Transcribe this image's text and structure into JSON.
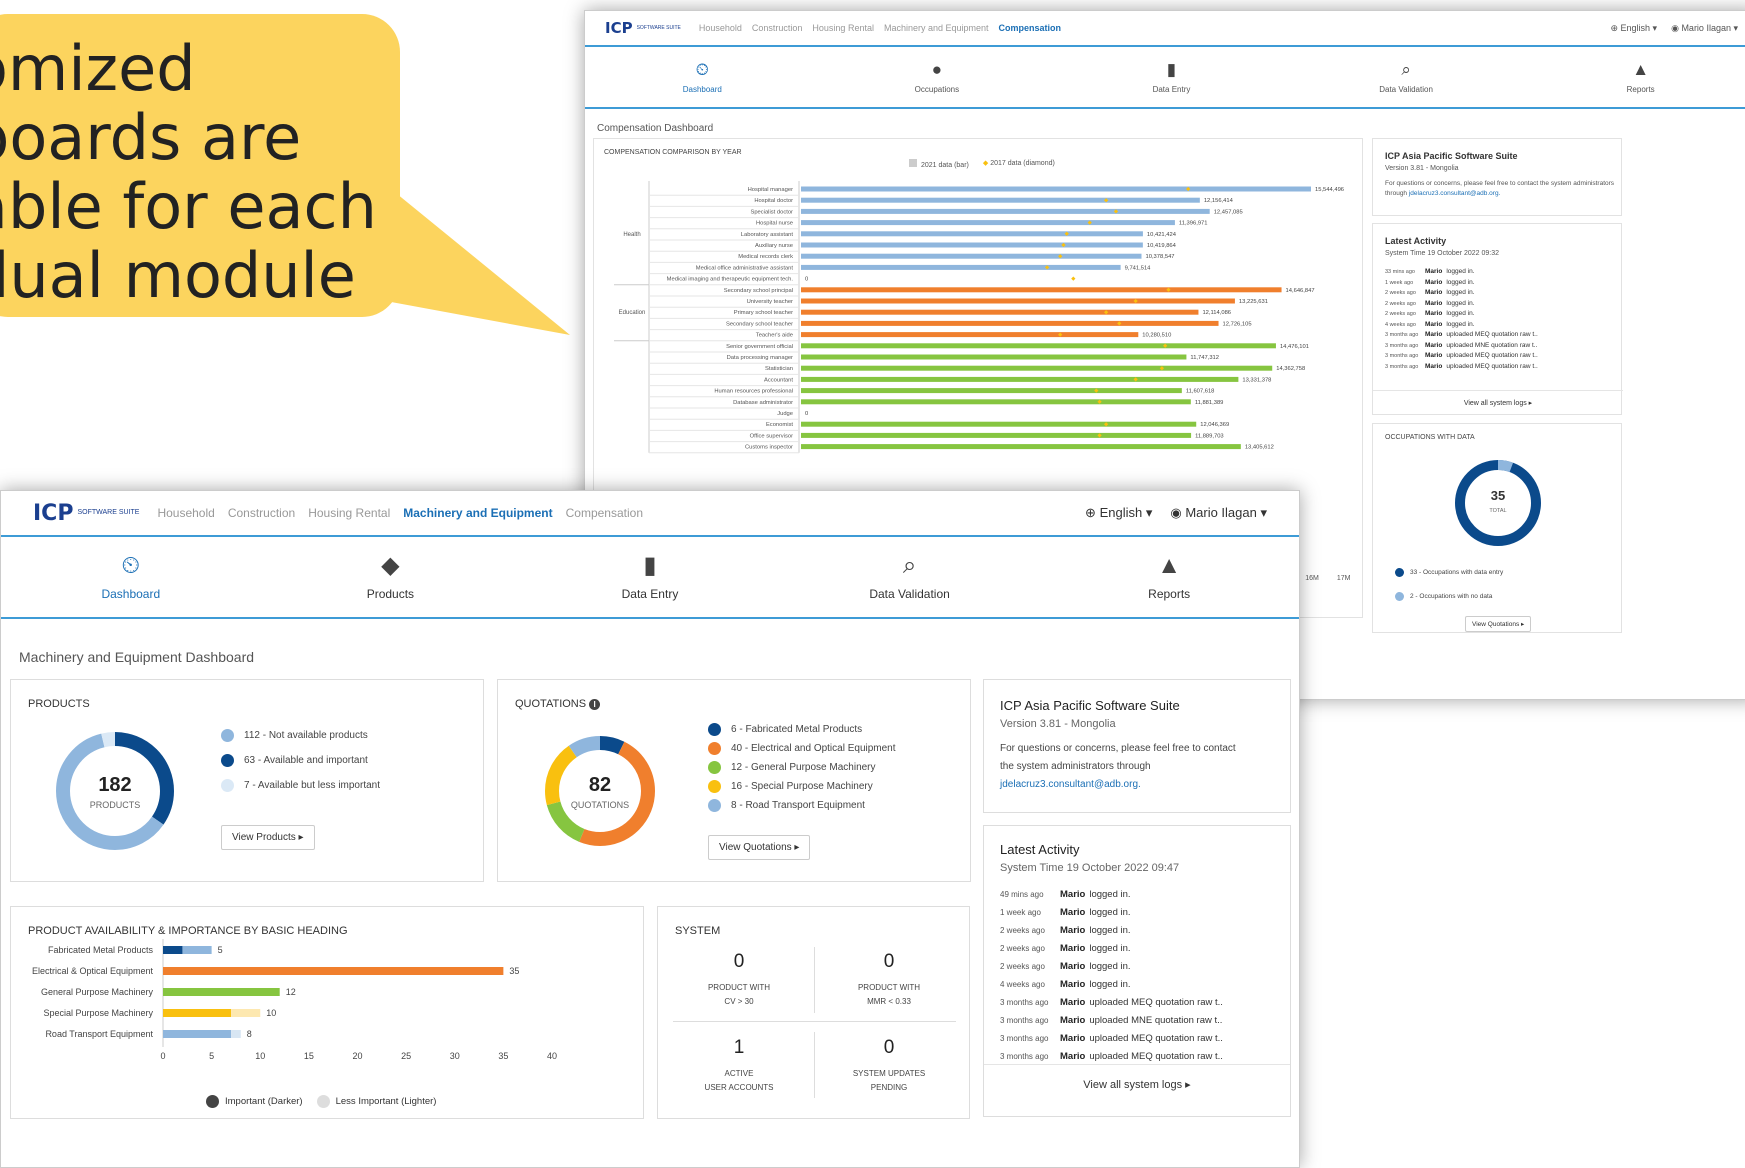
{
  "callout": {
    "lines": [
      "omized",
      "boards are",
      "able for each",
      "dual module"
    ]
  },
  "colors": {
    "callout": "#fcd45e",
    "dark_blue": "#0b4a8b",
    "light_blue": "#8fb6dd",
    "orange": "#f07f2d",
    "green": "#86c540",
    "yellow": "#f9c00f",
    "accent": "#1b6fb5"
  },
  "back": {
    "logo": "ICP",
    "logo_sub": "SOFTWARE SUITE",
    "nav": [
      "Household",
      "Construction",
      "Housing Rental",
      "Machinery and Equipment",
      "Compensation"
    ],
    "nav_active": "Compensation",
    "lang": "English",
    "user": "Mario Ilagan",
    "icons": [
      {
        "label": "Dashboard",
        "icon": "dashboard-icon"
      },
      {
        "label": "Occupations",
        "icon": "user-icon"
      },
      {
        "label": "Data Entry",
        "icon": "file-upload-icon"
      },
      {
        "label": "Data Validation",
        "icon": "search-icon"
      },
      {
        "label": "Reports",
        "icon": "area-chart-icon"
      }
    ],
    "page_title": "Compensation Dashboard",
    "chart_title": "COMPENSATION COMPARISON BY YEAR",
    "legend_2021": "2021 data (bar)",
    "legend_2017": "2017 data (diamond)",
    "groups": [
      {
        "name": "Health"
      },
      {
        "name": "Education"
      }
    ],
    "x_ticks": [
      "14M",
      "15M",
      "16M",
      "17M"
    ],
    "info_title": "ICP Asia Pacific Software Suite",
    "info_version": "Version 3.81 - Mongolia",
    "info_text": "For questions or concerns, please feel free to contact the system administrators through",
    "info_email": "jdelacruz3.consultant@adb.org.",
    "activity_title": "Latest Activity",
    "system_time": "System Time 19 October 2022 09:32",
    "activity": [
      {
        "t": "33 mins ago",
        "who": "Mario",
        "what": "logged in."
      },
      {
        "t": "1 week ago",
        "who": "Mario",
        "what": "logged in."
      },
      {
        "t": "2 weeks ago",
        "who": "Mario",
        "what": "logged in."
      },
      {
        "t": "2 weeks ago",
        "who": "Mario",
        "what": "logged in."
      },
      {
        "t": "2 weeks ago",
        "who": "Mario",
        "what": "logged in."
      },
      {
        "t": "4 weeks ago",
        "who": "Mario",
        "what": "logged in."
      },
      {
        "t": "3 months ago",
        "who": "Mario",
        "what": "uploaded MEQ quotation raw t.."
      },
      {
        "t": "3 months ago",
        "who": "Mario",
        "what": "uploaded MNE quotation raw t.."
      },
      {
        "t": "3 months ago",
        "who": "Mario",
        "what": "uploaded MEQ quotation raw t.."
      },
      {
        "t": "3 months ago",
        "who": "Mario",
        "what": "uploaded MEQ quotation raw t.."
      }
    ],
    "view_logs": "View all system logs",
    "occ_title": "OCCUPATIONS WITH DATA",
    "occ_total": "35",
    "occ_total_label": "TOTAL",
    "occ_legend": [
      "33 - Occupations with data entry",
      "2 - Occupations with no data"
    ],
    "view_quotations": "View Quotations"
  },
  "front": {
    "logo": "ICP",
    "logo_sub": "SOFTWARE SUITE",
    "nav": [
      "Household",
      "Construction",
      "Housing Rental",
      "Machinery and Equipment",
      "Compensation"
    ],
    "nav_active": "Machinery and Equipment",
    "lang": "English",
    "user": "Mario Ilagan",
    "icons": [
      {
        "label": "Dashboard",
        "icon": "dashboard-icon"
      },
      {
        "label": "Products",
        "icon": "tags-icon"
      },
      {
        "label": "Data Entry",
        "icon": "file-upload-icon"
      },
      {
        "label": "Data Validation",
        "icon": "search-icon"
      },
      {
        "label": "Reports",
        "icon": "area-chart-icon"
      }
    ],
    "page_title": "Machinery and Equipment Dashboard",
    "products": {
      "title": "PRODUCTS",
      "total": "182",
      "total_label": "PRODUCTS",
      "legend": [
        {
          "label": "112 - Not available products",
          "color": "#8fb6dd",
          "value": 112
        },
        {
          "label": "63 - Available and important",
          "color": "#0b4a8b",
          "value": 63
        },
        {
          "label": "7 - Available but less important",
          "color": "#dbe9f6",
          "value": 7
        }
      ],
      "button": "View Products"
    },
    "quotations": {
      "title": "QUOTATIONS",
      "total": "82",
      "total_label": "QUOTATIONS",
      "legend": [
        {
          "label": "6 - Fabricated Metal Products",
          "color": "#0b4a8b",
          "value": 6
        },
        {
          "label": "40 - Electrical and Optical Equipment",
          "color": "#f07f2d",
          "value": 40
        },
        {
          "label": "12 - General Purpose Machinery",
          "color": "#86c540",
          "value": 12
        },
        {
          "label": "16 - Special Purpose Machinery",
          "color": "#f9c00f",
          "value": 16
        },
        {
          "label": "8 - Road Transport Equipment",
          "color": "#8fb6dd",
          "value": 8
        }
      ],
      "button": "View Quotations"
    },
    "availability": {
      "title": "PRODUCT AVAILABILITY & IMPORTANCE BY BASIC HEADING",
      "legend_dark": "Important (Darker)",
      "legend_light": "Less Important (Lighter)"
    },
    "system": {
      "title": "SYSTEM",
      "cells": [
        {
          "value": "0",
          "line1": "PRODUCT WITH",
          "line2": "CV > 30"
        },
        {
          "value": "0",
          "line1": "PRODUCT WITH",
          "line2": "MMR < 0.33"
        },
        {
          "value": "1",
          "line1": "ACTIVE",
          "line2": "USER ACCOUNTS"
        },
        {
          "value": "0",
          "line1": "SYSTEM UPDATES",
          "line2": "PENDING"
        }
      ]
    },
    "info": {
      "title": "ICP Asia Pacific Software Suite",
      "version": "Version 3.81 - Mongolia",
      "text1": "For questions or concerns, please feel free to contact",
      "text2": "the system administrators through",
      "email": "jdelacruz3.consultant@adb.org."
    },
    "activity": {
      "title": "Latest Activity",
      "system_time": "System Time 19 October 2022 09:47",
      "rows": [
        {
          "t": "49 mins ago",
          "who": "Mario",
          "what": "logged in."
        },
        {
          "t": "1 week ago",
          "who": "Mario",
          "what": "logged in."
        },
        {
          "t": "2 weeks ago",
          "who": "Mario",
          "what": "logged in."
        },
        {
          "t": "2 weeks ago",
          "who": "Mario",
          "what": "logged in."
        },
        {
          "t": "2 weeks ago",
          "who": "Mario",
          "what": "logged in."
        },
        {
          "t": "4 weeks ago",
          "who": "Mario",
          "what": "logged in."
        },
        {
          "t": "3 months ago",
          "who": "Mario",
          "what": "uploaded MEQ quotation raw t.."
        },
        {
          "t": "3 months ago",
          "who": "Mario",
          "what": "uploaded MNE quotation raw t.."
        },
        {
          "t": "3 months ago",
          "who": "Mario",
          "what": "uploaded MEQ quotation raw t.."
        },
        {
          "t": "3 months ago",
          "who": "Mario",
          "what": "uploaded MEQ quotation raw t.."
        }
      ],
      "view_logs": "View all system logs"
    }
  },
  "chart_data": [
    {
      "type": "bar",
      "title": "COMPENSATION COMPARISON BY YEAR",
      "series": [
        {
          "name": "2021 data (bar)"
        },
        {
          "name": "2017 data (diamond)"
        }
      ],
      "rows": [
        {
          "group": "Health",
          "label": "Hospital manager",
          "value": 15544496,
          "value_label": "15,544,496",
          "color": "#8fb6dd",
          "d2017": 11800000
        },
        {
          "group": "Health",
          "label": "Hospital doctor",
          "value": 12156414,
          "value_label": "12,156,414",
          "color": "#8fb6dd",
          "d2017": 9300000
        },
        {
          "group": "Health",
          "label": "Specialist doctor",
          "value": 12457085,
          "value_label": "12,457,085",
          "color": "#8fb6dd",
          "d2017": 9600000
        },
        {
          "group": "Health",
          "label": "Hospital nurse",
          "value": 11396971,
          "value_label": "11,396,971",
          "color": "#8fb6dd",
          "d2017": 8800000
        },
        {
          "group": "Health",
          "label": "Laboratory assistant",
          "value": 10421424,
          "value_label": "10,421,424",
          "color": "#8fb6dd",
          "d2017": 8100000
        },
        {
          "group": "Health",
          "label": "Auxiliary nurse",
          "value": 10419864,
          "value_label": "10,419,864",
          "color": "#8fb6dd",
          "d2017": 8000000
        },
        {
          "group": "Health",
          "label": "Medical records clerk",
          "value": 10378547,
          "value_label": "10,378,547",
          "color": "#8fb6dd",
          "d2017": 7900000
        },
        {
          "group": "Health",
          "label": "Medical office administrative assistant",
          "value": 9741514,
          "value_label": "9,741,514",
          "color": "#8fb6dd",
          "d2017": 7500000
        },
        {
          "group": "Health",
          "label": "Medical imaging and therapeutic equipment tech.",
          "value": 0,
          "value_label": "0",
          "color": "#8fb6dd",
          "d2017": 8300000
        },
        {
          "group": "Education",
          "label": "Secondary school principal",
          "value": 14646847,
          "value_label": "14,646,847",
          "color": "#f07f2d",
          "d2017": 11200000
        },
        {
          "group": "Education",
          "label": "University teacher",
          "value": 13225631,
          "value_label": "13,225,631",
          "color": "#f07f2d",
          "d2017": 10200000
        },
        {
          "group": "Education",
          "label": "Primary school teacher",
          "value": 12114086,
          "value_label": "12,114,086",
          "color": "#f07f2d",
          "d2017": 9300000
        },
        {
          "group": "Education",
          "label": "Secondary school teacher",
          "value": 12726105,
          "value_label": "12,726,105",
          "color": "#f07f2d",
          "d2017": 9700000
        },
        {
          "group": "Education",
          "label": "Teacher's aide",
          "value": 10280510,
          "value_label": "10,280,510",
          "color": "#f07f2d",
          "d2017": 7900000
        },
        {
          "group": "",
          "label": "Senior government official",
          "value": 14476101,
          "value_label": "14,476,101",
          "color": "#86c540",
          "d2017": 11100000
        },
        {
          "group": "",
          "label": "Data processing manager",
          "value": 11747312,
          "value_label": "11,747,312",
          "color": "#86c540",
          "d2017": 0
        },
        {
          "group": "",
          "label": "Statistician",
          "value": 14362758,
          "value_label": "14,362,758",
          "color": "#86c540",
          "d2017": 11000000
        },
        {
          "group": "",
          "label": "Accountant",
          "value": 13331378,
          "value_label": "13,331,378",
          "color": "#86c540",
          "d2017": 10200000
        },
        {
          "group": "",
          "label": "Human resources professional",
          "value": 11607618,
          "value_label": "11,607,618",
          "color": "#86c540",
          "d2017": 9000000
        },
        {
          "group": "",
          "label": "Database administrator",
          "value": 11881389,
          "value_label": "11,881,389",
          "color": "#86c540",
          "d2017": 9100000
        },
        {
          "group": "",
          "label": "Judge",
          "value": 0,
          "value_label": "0",
          "color": "#86c540",
          "d2017": 0
        },
        {
          "group": "",
          "label": "Economist",
          "value": 12046369,
          "value_label": "12,046,369",
          "color": "#86c540",
          "d2017": 9300000
        },
        {
          "group": "",
          "label": "Office supervisor",
          "value": 11889703,
          "value_label": "11,889,703",
          "color": "#86c540",
          "d2017": 9100000
        },
        {
          "group": "",
          "label": "Customs inspector",
          "value": 13405612,
          "value_label": "13,405,612",
          "color": "#86c540",
          "d2017": 0
        }
      ],
      "xlim": [
        0,
        17000000
      ]
    },
    {
      "type": "pie",
      "title": "PRODUCTS",
      "categories": [
        "Not available products",
        "Available and important",
        "Available but less important"
      ],
      "values": [
        112,
        63,
        7
      ]
    },
    {
      "type": "pie",
      "title": "QUOTATIONS",
      "categories": [
        "Fabricated Metal Products",
        "Electrical and Optical Equipment",
        "General Purpose Machinery",
        "Special Purpose Machinery",
        "Road Transport Equipment"
      ],
      "values": [
        6,
        40,
        12,
        16,
        8
      ]
    },
    {
      "type": "bar",
      "title": "PRODUCT AVAILABILITY & IMPORTANCE BY BASIC HEADING",
      "categories": [
        "Fabricated Metal Products",
        "Electrical & Optical Equipment",
        "General Purpose Machinery",
        "Special Purpose Machinery",
        "Road Transport Equipment"
      ],
      "series": [
        {
          "name": "Important (Darker)",
          "values": [
            2,
            35,
            12,
            7,
            7
          ],
          "colors": [
            "#0b4a8b",
            "#f07f2d",
            "#86c540",
            "#f9c00f",
            "#8fb6dd"
          ]
        },
        {
          "name": "Less Important (Lighter)",
          "values": [
            3,
            0,
            0,
            3,
            1
          ],
          "colors": [
            "#8fb6dd",
            "#f9c6a3",
            "#cfe8b0",
            "#fde8b0",
            "#d8e6f3"
          ]
        }
      ],
      "totals": [
        5,
        35,
        12,
        10,
        8
      ],
      "xlim": [
        0,
        40
      ],
      "x_ticks": [
        0,
        5,
        10,
        15,
        20,
        25,
        30,
        35,
        40
      ]
    }
  ]
}
